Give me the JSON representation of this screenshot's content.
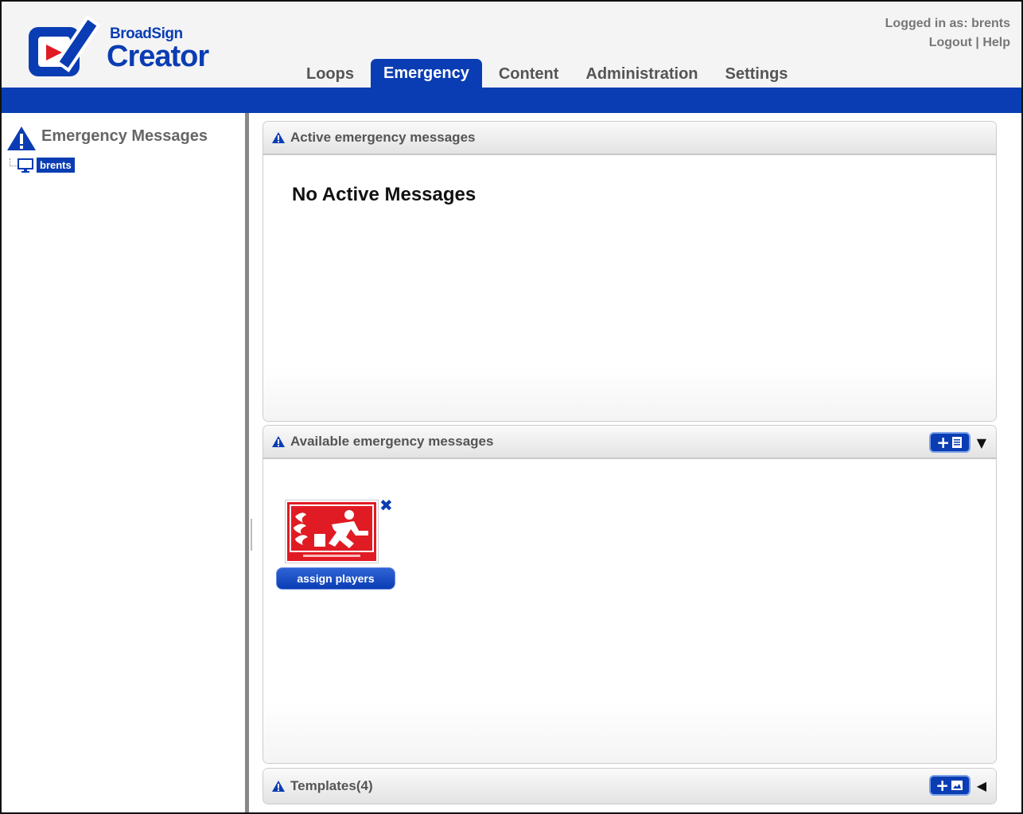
{
  "app": {
    "brand": "BroadSign",
    "product": "Creator"
  },
  "nav": {
    "tabs": [
      {
        "label": "Loops",
        "active": false
      },
      {
        "label": "Emergency",
        "active": true
      },
      {
        "label": "Content",
        "active": false
      },
      {
        "label": "Administration",
        "active": false
      },
      {
        "label": "Settings",
        "active": false
      }
    ]
  },
  "user": {
    "logged_in_text": "Logged in as: brents",
    "logout_label": "Logout",
    "separator": "|",
    "help_label": "Help"
  },
  "sidebar": {
    "title": "Emergency Messages",
    "tree": [
      {
        "label": "brents",
        "icon": "monitor-icon",
        "selected": true
      }
    ]
  },
  "panels": {
    "active": {
      "title": "Active emergency messages",
      "empty_text": "No Active Messages"
    },
    "available": {
      "title": "Available emergency messages",
      "messages": [
        {
          "thumbnail": "fire-exit-sign",
          "action_label": "assign players"
        }
      ]
    },
    "templates": {
      "title": "Templates(4)"
    }
  },
  "colors": {
    "brand_blue": "#0a3db3",
    "exit_sign_red": "#e01b24"
  }
}
